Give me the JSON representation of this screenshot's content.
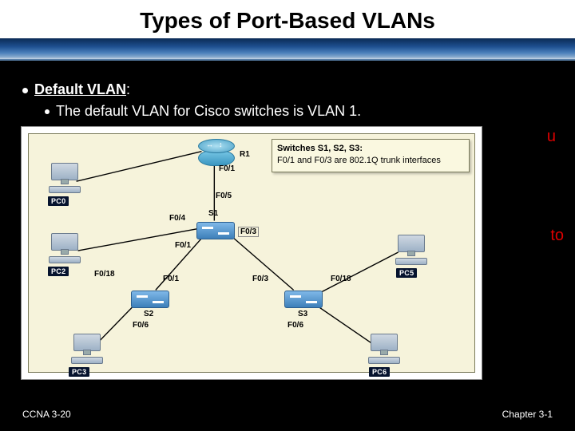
{
  "title": "Types of Port-Based VLANs",
  "bullets": {
    "b1": {
      "label": "Default VLAN",
      "suffix": ":"
    },
    "b2": "The default VLAN for Cisco switches is VLAN 1."
  },
  "partial_red": {
    "u": "u",
    "to": "to"
  },
  "footer": {
    "left": "CCNA 3-20",
    "right": "Chapter 3-1"
  },
  "callout": {
    "line1": "Switches S1, S2, S3:",
    "line2": "F0/1 and F0/3 are 802.1Q trunk interfaces"
  },
  "devices": {
    "r1": "R1",
    "s1": "S1",
    "s2": "S2",
    "s3": "S3",
    "pc0": "PC0",
    "pc2": "PC2",
    "pc3": "PC3",
    "pc5": "PC5",
    "pc6": "PC6"
  },
  "ports": {
    "r1_f01": "F0/1",
    "s1_f05": "F0/5",
    "s1_f04": "F0/4",
    "s1_f01": "F0/1",
    "s1_f03": "F0/3",
    "pc2_f018": "F0/18",
    "s2_f01": "F0/1",
    "s3_f03_left": "F0/3",
    "s3_f018": "F0/18",
    "s2_f06": "F0/6",
    "s3_f06": "F0/6"
  }
}
